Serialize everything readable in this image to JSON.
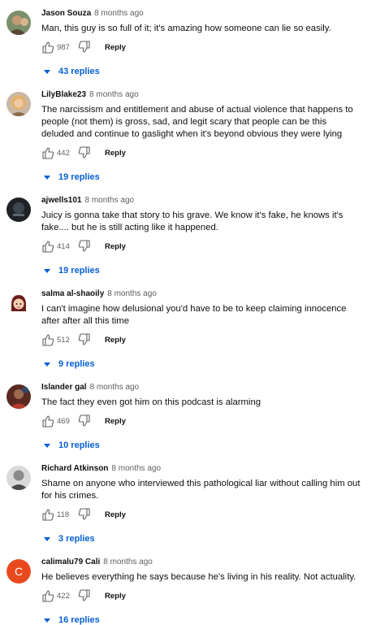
{
  "comments": [
    {
      "author": "Jason Souza",
      "time": "8 months ago",
      "text": "Man, this guy is so full of it; it's amazing how someone can lie so easily.",
      "likes": "987",
      "reply_label": "Reply",
      "replies": "43 replies",
      "avatar_icon": "avatar-photo-man-tan"
    },
    {
      "author": "LilyBlake23",
      "time": "8 months ago",
      "text": "The narcissism and entitlement and abuse of actual violence that happens to people (not them) is gross, sad, and legit scary that people can be this deluded and continue to gaslight when it's beyond obvious they were lying",
      "likes": "442",
      "reply_label": "Reply",
      "replies": "19 replies",
      "avatar_icon": "avatar-photo-woman-blonde"
    },
    {
      "author": "ajwells101",
      "time": "8 months ago",
      "text": "Juicy is gonna take that story to his grave. We know it's fake, he knows it's fake.... but he is still acting like it happened.",
      "likes": "414",
      "reply_label": "Reply",
      "replies": "19 replies",
      "avatar_icon": "avatar-dark-logo"
    },
    {
      "author": "salma al-shaoily",
      "time": "8 months ago",
      "text": "I can't imagine how delusional you'd have to be to keep claiming innocence after after all this time",
      "likes": "512",
      "reply_label": "Reply",
      "replies": "9 replies",
      "avatar_icon": "avatar-cartoon-girl"
    },
    {
      "author": "Islander gal",
      "time": "8 months ago",
      "text": "The fact they even got him on this podcast is alarming",
      "likes": "469",
      "reply_label": "Reply",
      "replies": "10 replies",
      "avatar_icon": "avatar-photo-dark-red"
    },
    {
      "author": "Richard Atkinson",
      "time": "8 months ago",
      "text": "Shame on anyone who interviewed this pathological liar without calling him out for his crimes.",
      "likes": "118",
      "reply_label": "Reply",
      "replies": "3 replies",
      "avatar_icon": "avatar-photo-man-grey"
    },
    {
      "author": "calimalu79 Cali",
      "time": "8 months ago",
      "text": "He believes everything he says because he's living in his reality. Not actuality.",
      "likes": "422",
      "reply_label": "Reply",
      "replies": "16 replies",
      "avatar_icon": "avatar-letter-c",
      "avatar_letter": "C"
    }
  ],
  "colors": {
    "link_blue": "#065fd4",
    "meta_grey": "#606060",
    "text": "#0f0f0f",
    "letter_avatar_bg": "#e8491d"
  }
}
